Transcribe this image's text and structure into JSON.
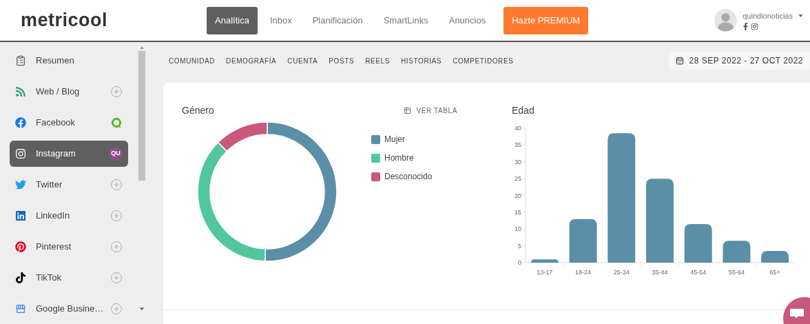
{
  "header": {
    "logo": "metricool",
    "nav": [
      {
        "label": "Analítica",
        "selected": true
      },
      {
        "label": "Inbox",
        "selected": false
      },
      {
        "label": "Planificación",
        "selected": false
      },
      {
        "label": "SmartLinks",
        "selected": false
      },
      {
        "label": "Anuncios",
        "selected": false
      }
    ],
    "premium": "Hazte PREMIUM",
    "account": {
      "name": "quindionoticias"
    }
  },
  "sidebar": {
    "items": [
      {
        "label": "Resumen",
        "kind": "plain",
        "selected": false
      },
      {
        "label": "Web / Blog",
        "kind": "add",
        "selected": false
      },
      {
        "label": "Facebook",
        "kind": "logo",
        "selected": false
      },
      {
        "label": "Instagram",
        "kind": "avatar",
        "avatar_text": "QU",
        "selected": true
      },
      {
        "label": "Twitter",
        "kind": "add",
        "selected": false
      },
      {
        "label": "LinkedIn",
        "kind": "add",
        "selected": false
      },
      {
        "label": "Pinterest",
        "kind": "add",
        "selected": false
      },
      {
        "label": "TikTok",
        "kind": "add",
        "selected": false
      },
      {
        "label": "Google Busine…",
        "kind": "add",
        "selected": false
      }
    ]
  },
  "tabs": [
    "COMUNIDAD",
    "DEMOGRAFÍA",
    "CUENTA",
    "POSTS",
    "REELS",
    "HISTORIAS",
    "COMPETIDORES"
  ],
  "date_range": "28 SEP 2022 - 27 OCT 2022",
  "gender": {
    "title": "Género",
    "table_button": "VER TABLA",
    "chart_data": {
      "type": "donut",
      "categories": [
        "Mujer",
        "Hombre",
        "Desconocido"
      ],
      "values": [
        50.5,
        37,
        12.5
      ],
      "colors": [
        "#5b8fa8",
        "#52c79e",
        "#c8587c"
      ]
    }
  },
  "age": {
    "title": "Edad",
    "chart_data": {
      "type": "bar",
      "categories": [
        "13-17",
        "18-24",
        "25-34",
        "35-44",
        "45-54",
        "55-64",
        "65+"
      ],
      "values": [
        1,
        13,
        38.5,
        25,
        11.5,
        6.5,
        3.5
      ],
      "ylim": [
        0,
        40
      ],
      "yticks": [
        0,
        5,
        10,
        15,
        20,
        25,
        30,
        35,
        40
      ]
    }
  }
}
